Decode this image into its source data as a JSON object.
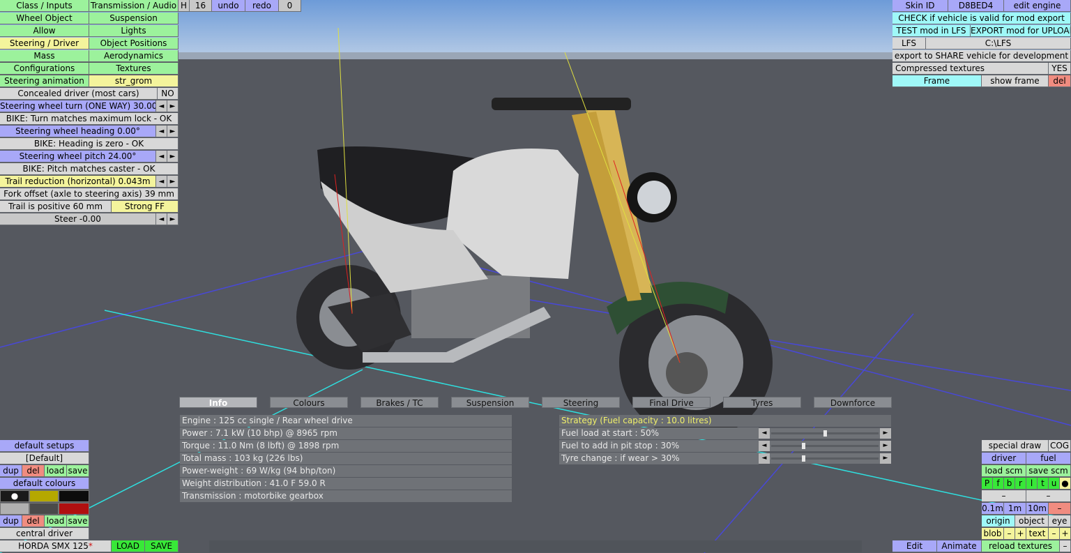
{
  "top_left_tabs": [
    [
      "Class / Inputs",
      "Transmission / Audio"
    ],
    [
      "Wheel Object",
      "Suspension"
    ],
    [
      "Allow",
      "Lights"
    ],
    [
      "Steering / Driver",
      "Object Positions"
    ],
    [
      "Mass",
      "Aerodynamics"
    ],
    [
      "Configurations",
      "Textures"
    ]
  ],
  "toolbar": {
    "h": "H",
    "count": "16",
    "undo": "undo",
    "redo": "redo",
    "redo_count": "0"
  },
  "steering": {
    "anim_label": "Steering animation",
    "anim_value": "str_grom",
    "concealed_label": "Concealed driver (most cars)",
    "concealed_value": "NO",
    "turn": "Steering wheel turn (ONE WAY) 30.00°",
    "turn_msg": "BIKE: Turn matches maximum lock - OK",
    "heading": "Steering wheel heading 0.00°",
    "heading_msg": "BIKE: Heading is zero - OK",
    "pitch": "Steering wheel pitch 24.00°",
    "pitch_msg": "BIKE: Pitch matches caster - OK",
    "trail": "Trail reduction (horizontal) 0.043m",
    "fork": "Fork offset (axle to steering axis) 39 mm",
    "trail_pos": "Trail is positive 60 mm",
    "strong_ff": "Strong FF",
    "steer": "Steer -0.00",
    "arrow_left": "◄",
    "arrow_right": "►"
  },
  "top_right": {
    "skin_label": "Skin ID",
    "skin_value": "D8BED4",
    "edit_engine": "edit engine",
    "check": "CHECK if vehicle is valid for mod export",
    "test": "TEST mod in LFS",
    "export": "EXPORT mod for UPLOAD",
    "lfs": "LFS",
    "path": "C:\\LFS",
    "share": "export to SHARE vehicle for development",
    "compressed": "Compressed textures",
    "compressed_value": "YES",
    "frame": "Frame",
    "show_frame": "show frame",
    "del": "del"
  },
  "tabs": [
    "Info",
    "Colours",
    "Brakes / TC",
    "Suspension",
    "Steering",
    "Final Drive",
    "Tyres",
    "Downforce"
  ],
  "info_lines": [
    "Engine : 125 cc single / Rear wheel drive",
    "Power : 7.1 kW (10 bhp) @ 8965 rpm",
    "Torque : 11.0 Nm (8 lbft) @ 1898 rpm",
    "Total mass : 103 kg (226 lbs)",
    "Power-weight : 69 W/kg (94 bhp/ton)",
    "Weight distribution : 41.0 F  59.0 R",
    "Transmission : motorbike gearbox"
  ],
  "fuel": {
    "strategy": "Strategy (Fuel capacity : 10.0 litres)",
    "rows": [
      {
        "label": "Fuel load at start : 50%",
        "pos": 0.5
      },
      {
        "label": "Fuel to add in pit stop : 30%",
        "pos": 0.3
      },
      {
        "label": "Tyre change : if wear > 30%",
        "pos": 0.3
      }
    ]
  },
  "bottom_left": {
    "default_setups": "default setups",
    "default_item": "[Default]",
    "dup": "dup",
    "del": "del",
    "load": "load",
    "save": "save",
    "default_colours": "default colours",
    "central_driver": "central driver",
    "vehicle": "HORDA SMX 125",
    "asterisk": "*",
    "LOAD": "LOAD",
    "SAVE": "SAVE",
    "dot": "●"
  },
  "bottom_right": {
    "special_draw": "special draw",
    "cog": "COG",
    "driver": "driver",
    "fuel": "fuel",
    "load_scm": "load scm",
    "save_scm": "save scm",
    "letters": [
      "P",
      "f",
      "b",
      "r",
      "l",
      "t",
      "u"
    ],
    "dot": "●",
    "minus": "–",
    "steps": [
      "0.1m",
      "1m",
      "10m"
    ],
    "origin": "origin",
    "object": "object",
    "eye": "eye",
    "blob": "blob",
    "plus": "+",
    "text": "text",
    "edit": "Edit",
    "animate": "Animate",
    "reload": "reload textures"
  }
}
